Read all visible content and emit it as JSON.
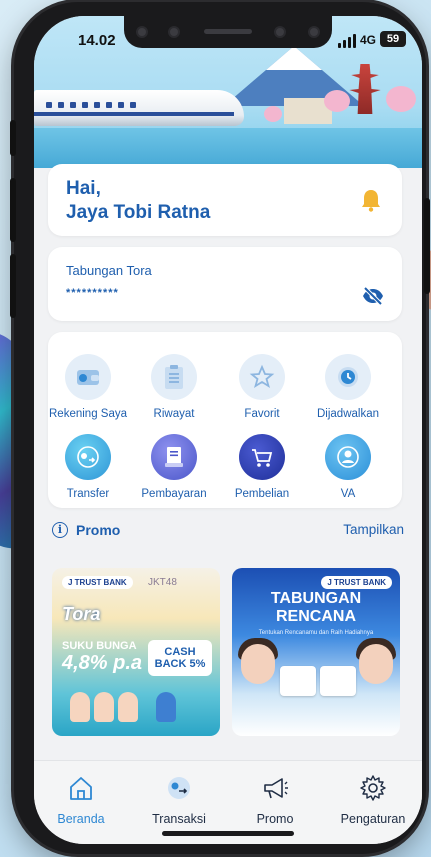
{
  "status_bar": {
    "time": "14.02",
    "network": "4G",
    "battery": "59"
  },
  "greeting": {
    "line1": "Hai,",
    "line2": "Jaya Tobi Ratna"
  },
  "account": {
    "name": "Tabungan Tora",
    "masked_balance": "**********"
  },
  "menu": {
    "rekening": "Rekening Saya",
    "riwayat": "Riwayat",
    "favorit": "Favorit",
    "dijadwalkan": "Dijadwalkan",
    "transfer": "Transfer",
    "pembayaran": "Pembayaran",
    "pembelian": "Pembelian",
    "va": "VA"
  },
  "promo": {
    "title": "Promo",
    "link": "Tampilkan",
    "card1": {
      "logo": "J TRUST BANK",
      "brand": "JKT48",
      "product": "Tora",
      "rate_label": "SUKU BUNGA",
      "rate": "4,8% p.a",
      "cashback": "CASH BACK 5%"
    },
    "card2": {
      "logo": "J TRUST BANK",
      "title1": "TABUNGAN",
      "title2": "RENCANA",
      "subtitle": "Tentukan Rencanamu dan Raih Hadiahnya"
    }
  },
  "nav": {
    "home": "Beranda",
    "transactions": "Transaksi",
    "promo": "Promo",
    "settings": "Pengaturan",
    "active": "Beranda"
  },
  "colors": {
    "primary": "#1f5fae",
    "active_nav": "#2e88d3",
    "bell": "#f2b534"
  }
}
